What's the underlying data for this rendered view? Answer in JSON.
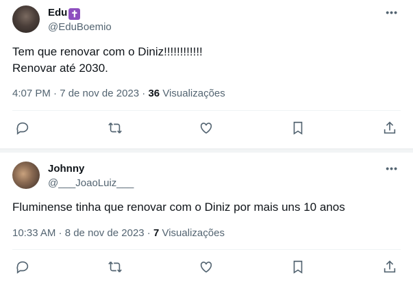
{
  "tweets": [
    {
      "name": "Edu",
      "badge": "✝",
      "handle": "@EduBoemio",
      "lines": [
        "Tem que renovar com o Diniz!!!!!!!!!!!!",
        "Renovar até 2030."
      ],
      "time": "4:07 PM · 7 de nov de 2023 · ",
      "views_count": "36",
      "views_label": " Visualizações"
    },
    {
      "name": "Johnny",
      "handle": "@___JoaoLuiz___",
      "lines": [
        "Fluminense tinha que renovar com o Diniz por mais uns 10 anos"
      ],
      "time": "10:33 AM · 8 de nov de 2023 · ",
      "views_count": "7",
      "views_label": " Visualizações"
    }
  ],
  "more_label": "•••",
  "icons": [
    "reply-icon",
    "retweet-icon",
    "like-icon",
    "bookmark-icon",
    "share-icon"
  ]
}
